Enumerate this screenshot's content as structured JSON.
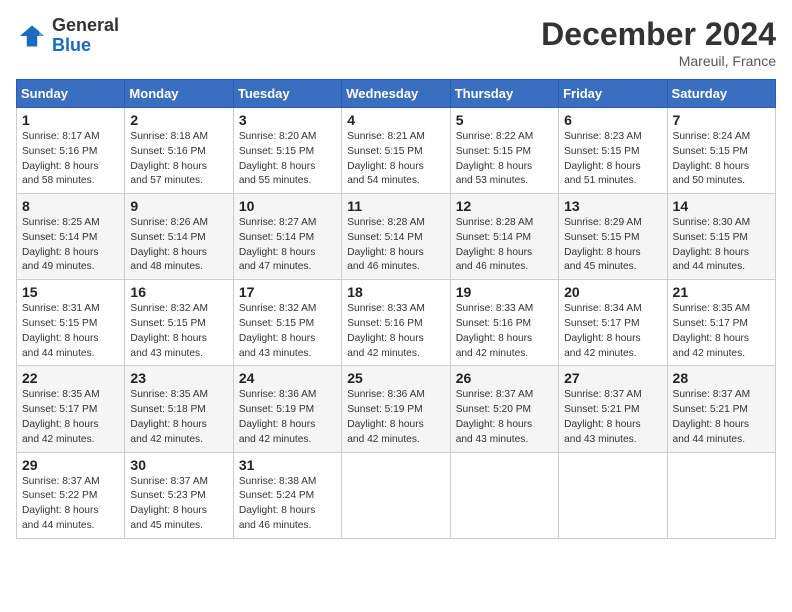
{
  "logo": {
    "general": "General",
    "blue": "Blue"
  },
  "title": "December 2024",
  "location": "Mareuil, France",
  "weekdays": [
    "Sunday",
    "Monday",
    "Tuesday",
    "Wednesday",
    "Thursday",
    "Friday",
    "Saturday"
  ],
  "weeks": [
    [
      {
        "day": "1",
        "info": "Sunrise: 8:17 AM\nSunset: 5:16 PM\nDaylight: 8 hours\nand 58 minutes."
      },
      {
        "day": "2",
        "info": "Sunrise: 8:18 AM\nSunset: 5:16 PM\nDaylight: 8 hours\nand 57 minutes."
      },
      {
        "day": "3",
        "info": "Sunrise: 8:20 AM\nSunset: 5:15 PM\nDaylight: 8 hours\nand 55 minutes."
      },
      {
        "day": "4",
        "info": "Sunrise: 8:21 AM\nSunset: 5:15 PM\nDaylight: 8 hours\nand 54 minutes."
      },
      {
        "day": "5",
        "info": "Sunrise: 8:22 AM\nSunset: 5:15 PM\nDaylight: 8 hours\nand 53 minutes."
      },
      {
        "day": "6",
        "info": "Sunrise: 8:23 AM\nSunset: 5:15 PM\nDaylight: 8 hours\nand 51 minutes."
      },
      {
        "day": "7",
        "info": "Sunrise: 8:24 AM\nSunset: 5:15 PM\nDaylight: 8 hours\nand 50 minutes."
      }
    ],
    [
      {
        "day": "8",
        "info": "Sunrise: 8:25 AM\nSunset: 5:14 PM\nDaylight: 8 hours\nand 49 minutes."
      },
      {
        "day": "9",
        "info": "Sunrise: 8:26 AM\nSunset: 5:14 PM\nDaylight: 8 hours\nand 48 minutes."
      },
      {
        "day": "10",
        "info": "Sunrise: 8:27 AM\nSunset: 5:14 PM\nDaylight: 8 hours\nand 47 minutes."
      },
      {
        "day": "11",
        "info": "Sunrise: 8:28 AM\nSunset: 5:14 PM\nDaylight: 8 hours\nand 46 minutes."
      },
      {
        "day": "12",
        "info": "Sunrise: 8:28 AM\nSunset: 5:14 PM\nDaylight: 8 hours\nand 46 minutes."
      },
      {
        "day": "13",
        "info": "Sunrise: 8:29 AM\nSunset: 5:15 PM\nDaylight: 8 hours\nand 45 minutes."
      },
      {
        "day": "14",
        "info": "Sunrise: 8:30 AM\nSunset: 5:15 PM\nDaylight: 8 hours\nand 44 minutes."
      }
    ],
    [
      {
        "day": "15",
        "info": "Sunrise: 8:31 AM\nSunset: 5:15 PM\nDaylight: 8 hours\nand 44 minutes."
      },
      {
        "day": "16",
        "info": "Sunrise: 8:32 AM\nSunset: 5:15 PM\nDaylight: 8 hours\nand 43 minutes."
      },
      {
        "day": "17",
        "info": "Sunrise: 8:32 AM\nSunset: 5:15 PM\nDaylight: 8 hours\nand 43 minutes."
      },
      {
        "day": "18",
        "info": "Sunrise: 8:33 AM\nSunset: 5:16 PM\nDaylight: 8 hours\nand 42 minutes."
      },
      {
        "day": "19",
        "info": "Sunrise: 8:33 AM\nSunset: 5:16 PM\nDaylight: 8 hours\nand 42 minutes."
      },
      {
        "day": "20",
        "info": "Sunrise: 8:34 AM\nSunset: 5:17 PM\nDaylight: 8 hours\nand 42 minutes."
      },
      {
        "day": "21",
        "info": "Sunrise: 8:35 AM\nSunset: 5:17 PM\nDaylight: 8 hours\nand 42 minutes."
      }
    ],
    [
      {
        "day": "22",
        "info": "Sunrise: 8:35 AM\nSunset: 5:17 PM\nDaylight: 8 hours\nand 42 minutes."
      },
      {
        "day": "23",
        "info": "Sunrise: 8:35 AM\nSunset: 5:18 PM\nDaylight: 8 hours\nand 42 minutes."
      },
      {
        "day": "24",
        "info": "Sunrise: 8:36 AM\nSunset: 5:19 PM\nDaylight: 8 hours\nand 42 minutes."
      },
      {
        "day": "25",
        "info": "Sunrise: 8:36 AM\nSunset: 5:19 PM\nDaylight: 8 hours\nand 42 minutes."
      },
      {
        "day": "26",
        "info": "Sunrise: 8:37 AM\nSunset: 5:20 PM\nDaylight: 8 hours\nand 43 minutes."
      },
      {
        "day": "27",
        "info": "Sunrise: 8:37 AM\nSunset: 5:21 PM\nDaylight: 8 hours\nand 43 minutes."
      },
      {
        "day": "28",
        "info": "Sunrise: 8:37 AM\nSunset: 5:21 PM\nDaylight: 8 hours\nand 44 minutes."
      }
    ],
    [
      {
        "day": "29",
        "info": "Sunrise: 8:37 AM\nSunset: 5:22 PM\nDaylight: 8 hours\nand 44 minutes."
      },
      {
        "day": "30",
        "info": "Sunrise: 8:37 AM\nSunset: 5:23 PM\nDaylight: 8 hours\nand 45 minutes."
      },
      {
        "day": "31",
        "info": "Sunrise: 8:38 AM\nSunset: 5:24 PM\nDaylight: 8 hours\nand 46 minutes."
      },
      null,
      null,
      null,
      null
    ]
  ]
}
